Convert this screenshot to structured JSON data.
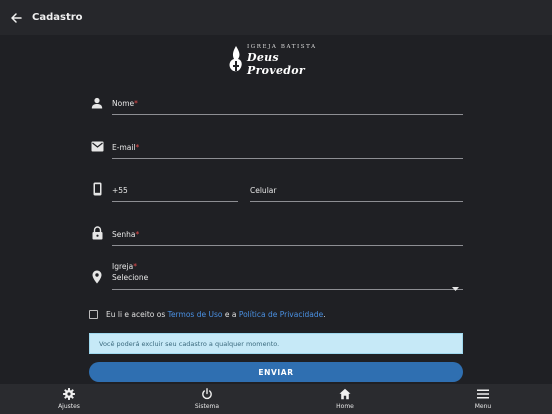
{
  "appbar": {
    "title": "Cadastro",
    "back_icon": "arrow-left-icon"
  },
  "logo": {
    "line1": "IGREJA BATISTA",
    "line2": "Deus Provedor"
  },
  "form": {
    "name": {
      "label": "Nome",
      "required": "*"
    },
    "email": {
      "label": "E-mail",
      "required": "*"
    },
    "phone": {
      "country_code": "+55",
      "label": "Celular"
    },
    "password": {
      "label": "Senha",
      "required": "*"
    },
    "church": {
      "label": "Igreja",
      "required": "*",
      "value": "Selecione"
    }
  },
  "terms": {
    "prefix": "Eu li e aceito os ",
    "terms_link": "Termos de Uso",
    "middle": " e a ",
    "privacy_link": "Política de Privacidade",
    "suffix": "."
  },
  "alert": {
    "text": "Você poderá excluir seu cadastro a qualquer momento."
  },
  "submit": {
    "label": "ENVIAR"
  },
  "bottom_nav": [
    {
      "label": "Ajustes",
      "icon": "gear-icon"
    },
    {
      "label": "Sistema",
      "icon": "power-icon"
    },
    {
      "label": "Home",
      "icon": "home-icon"
    },
    {
      "label": "Menu",
      "icon": "hamburger-icon"
    }
  ],
  "colors": {
    "background": "#1f2024",
    "appbar": "#26272b",
    "link": "#4a90e2",
    "button": "#2f6fb1",
    "alert_bg": "#c6e9f7",
    "required": "#e24b4b"
  }
}
